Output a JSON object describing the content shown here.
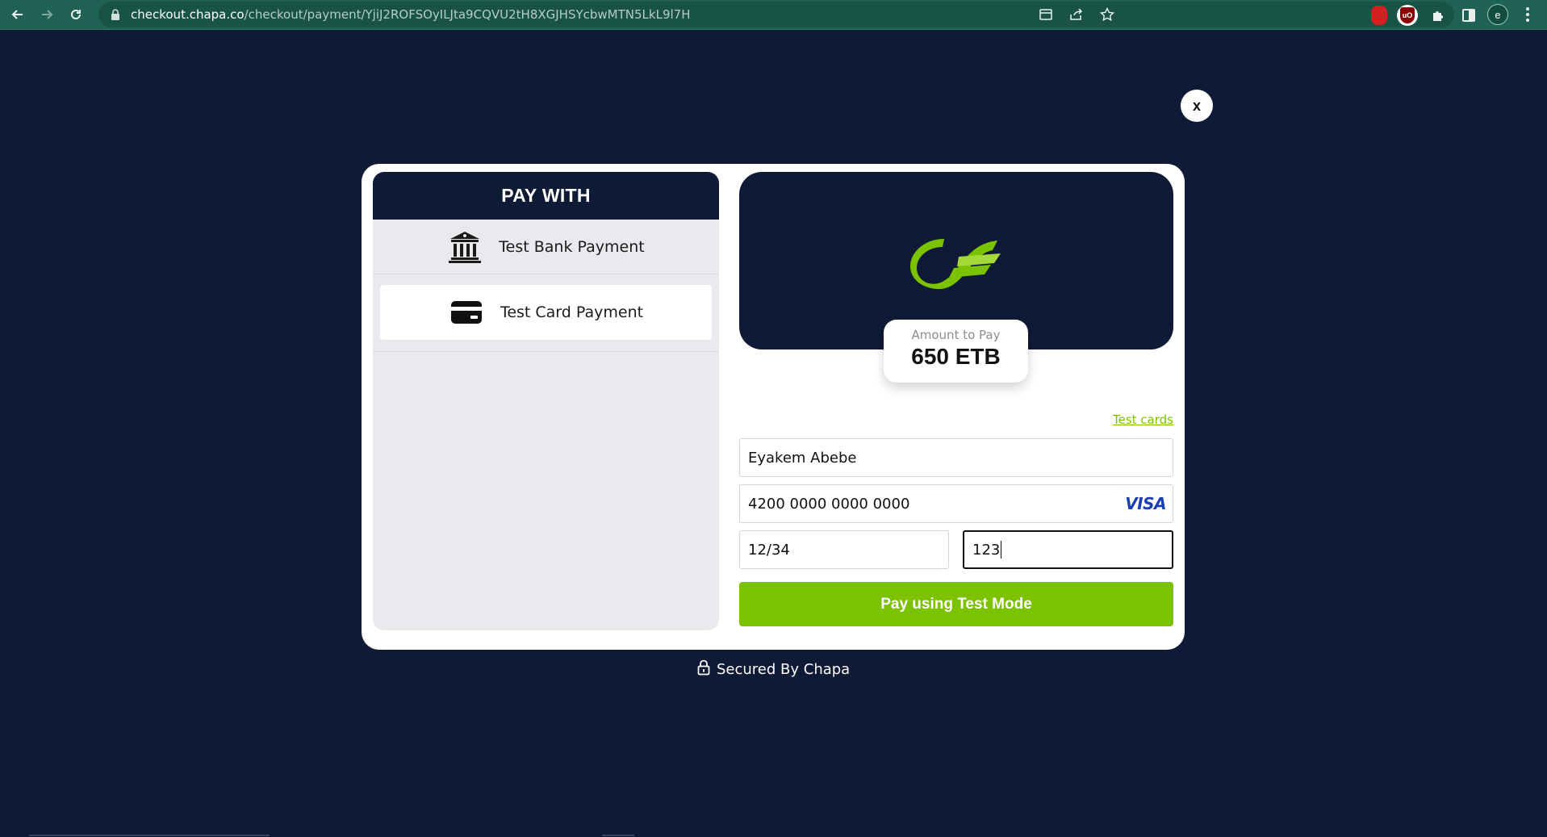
{
  "browser": {
    "url_host": "checkout.chapa.co",
    "url_path": "/checkout/payment/YjiJ2ROFSOyILJta9CQVU2tH8XGJHSYcbwMTN5LkL9l7H",
    "profile_initial": "e"
  },
  "modal": {
    "close_label": "x",
    "pay_with_title": "PAY WITH",
    "methods": [
      {
        "label": "Test Bank Payment",
        "icon": "bank-icon"
      },
      {
        "label": "Test Card Payment",
        "icon": "credit-card-icon"
      }
    ],
    "amount_label": "Amount to Pay",
    "amount_value": "650 ETB",
    "test_cards_link": "Test cards",
    "form": {
      "name_value": "Eyakem Abebe",
      "card_number_value": "4200 0000 0000 0000",
      "card_brand": "VISA",
      "expiry_value": "12/34",
      "cvv_value": "123"
    },
    "pay_button_label": "Pay using Test Mode"
  },
  "footer": {
    "secured_text": "Secured By Chapa"
  },
  "colors": {
    "background": "#0f1a36",
    "accent_green": "#7bc300",
    "chrome": "#1f6255",
    "visa_blue": "#1a3fb4"
  }
}
